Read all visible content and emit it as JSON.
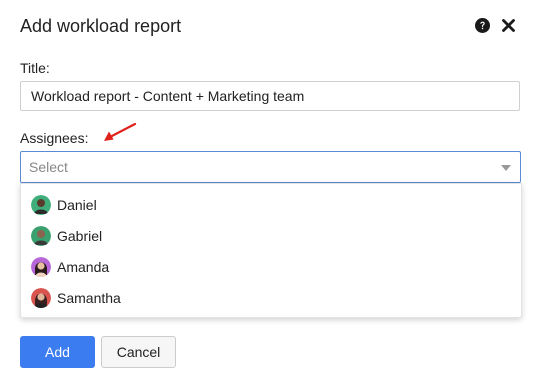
{
  "dialog": {
    "title": "Add workload report",
    "help_icon": "question-circle-icon",
    "close_icon": "close-icon"
  },
  "form": {
    "title_label": "Title:",
    "title_value": "Workload report - Content + Marketing team",
    "assignees_label": "Assignees:",
    "assignees_placeholder": "Select",
    "annotation": "red-arrow-pointing-to-assignees"
  },
  "dropdown": {
    "options": [
      {
        "label": "Daniel",
        "avatar_color": "#3fae7a"
      },
      {
        "label": "Gabriel",
        "avatar_color": "#3aa06e"
      },
      {
        "label": "Amanda",
        "avatar_color": "#b867d8"
      },
      {
        "label": "Samantha",
        "avatar_color": "#d9534f"
      }
    ]
  },
  "buttons": {
    "add_label": "Add",
    "cancel_label": "Cancel"
  },
  "colors": {
    "primary": "#3b7cf0",
    "select_border": "#5a8cd6",
    "annotation_red": "#e0201b"
  }
}
